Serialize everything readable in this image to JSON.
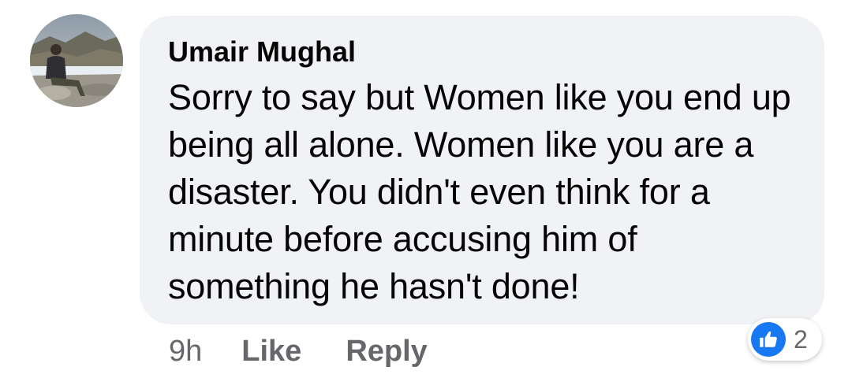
{
  "comment": {
    "author": "Umair Mughal",
    "text": "Sorry to say but Women like you end up being all alone. Women like you are a disaster. You didn't even think for a minute before accusing him of something he hasn't done!",
    "timestamp": "9h",
    "like_label": "Like",
    "reply_label": "Reply",
    "reactions": {
      "icon": "thumbs-up-icon",
      "count": "2"
    }
  },
  "colors": {
    "bubble": "#f0f2f5",
    "text": "#050505",
    "secondary": "#65676b",
    "like_blue": "#1877f2"
  }
}
